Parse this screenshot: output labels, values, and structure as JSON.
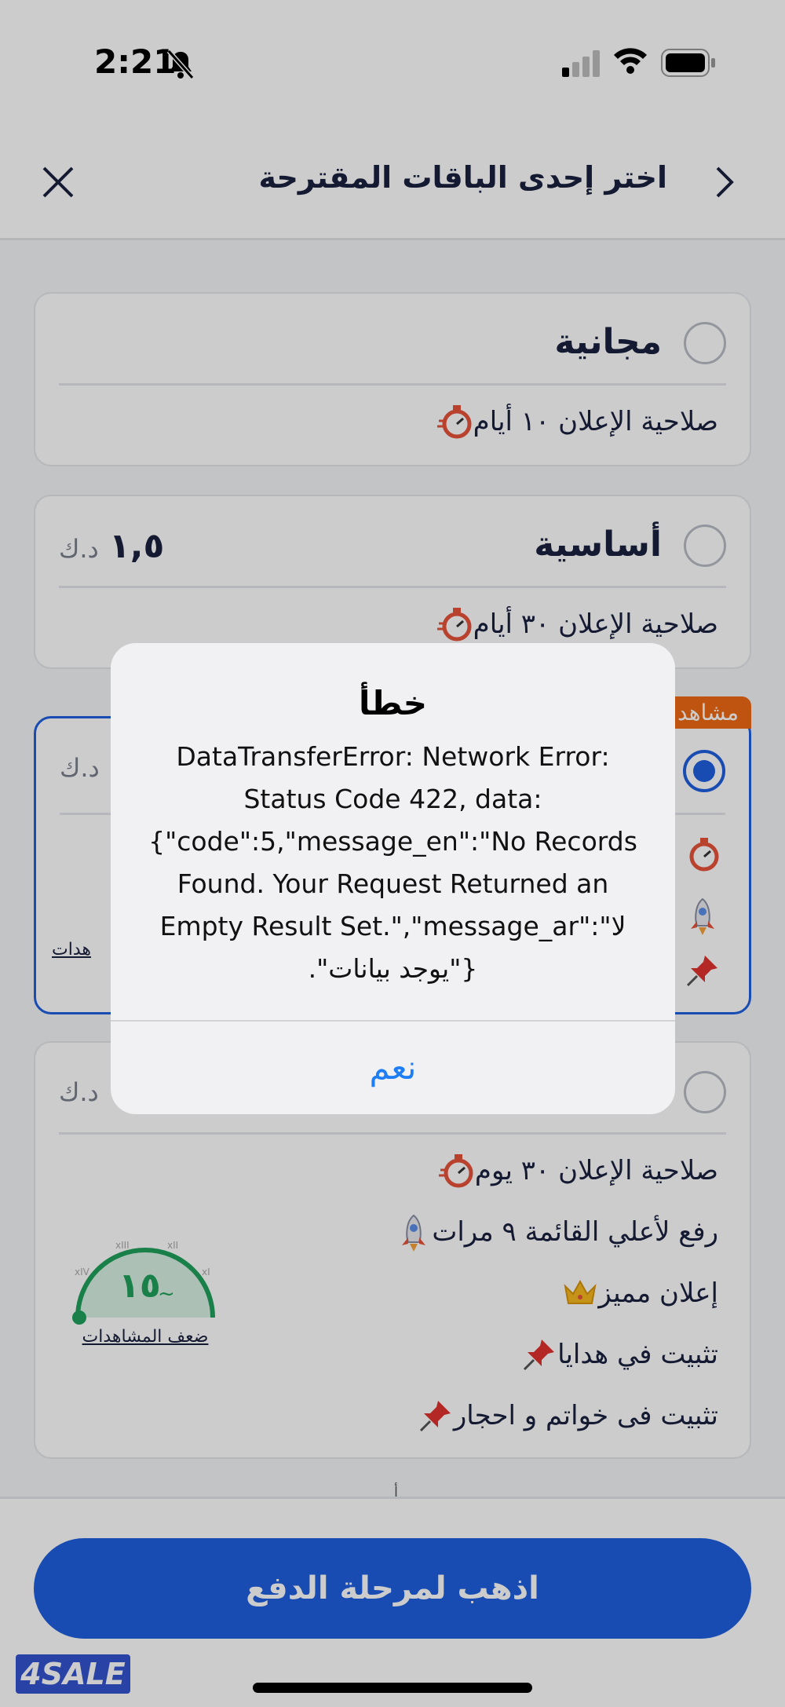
{
  "status_bar": {
    "time": "2:21"
  },
  "header": {
    "title": "اختر إحدى الباقات المقترحة"
  },
  "plans": [
    {
      "name": "مجانية",
      "price": "",
      "currency": "",
      "features": [
        "صلاحية الإعلان ١٠ أيام"
      ],
      "selected": false
    },
    {
      "name": "أساسية",
      "price": "١,٥",
      "currency": "د.ك",
      "features": [
        "صلاحية الإعلان ٣٠ أيام"
      ],
      "selected": false
    },
    {
      "name": "",
      "price": "",
      "currency": "د.ك",
      "badge": "مشاهد",
      "gauge_caption": "هدات",
      "selected": true
    },
    {
      "name": "",
      "price": "",
      "currency": "د.ك",
      "features": [
        "صلاحية الإعلان ٣٠ يوم",
        "رفع لأعلي القائمة ٩ مرات",
        "إعلان مميز",
        "تثبيت في هدايا",
        "تثبيت فى خواتم و احجار"
      ],
      "gauge_value": "١٥",
      "gauge_caption": "ضعف المشاهدات",
      "selected": false
    }
  ],
  "bottom": {
    "pay_button": "اذهب لمرحلة الدفع",
    "logo": "4SALE",
    "hint": "أ"
  },
  "dialog": {
    "title": "خطأ",
    "message": "DataTransferError: Network Error:\nStatus Code 422, data:\n{\"code\":5,\"message_en\":\"No Records\nFound. Your Request Returned an\nEmpty Result Set.\",\"message_ar\":\"لا\n.\"يوجد بيانات\"}",
    "ok_button": "نعم"
  },
  "colors": {
    "primary": "#1e5fe0",
    "badge": "#ee6a13",
    "gauge": "#1fa05a",
    "link": "#1e7ef5"
  }
}
